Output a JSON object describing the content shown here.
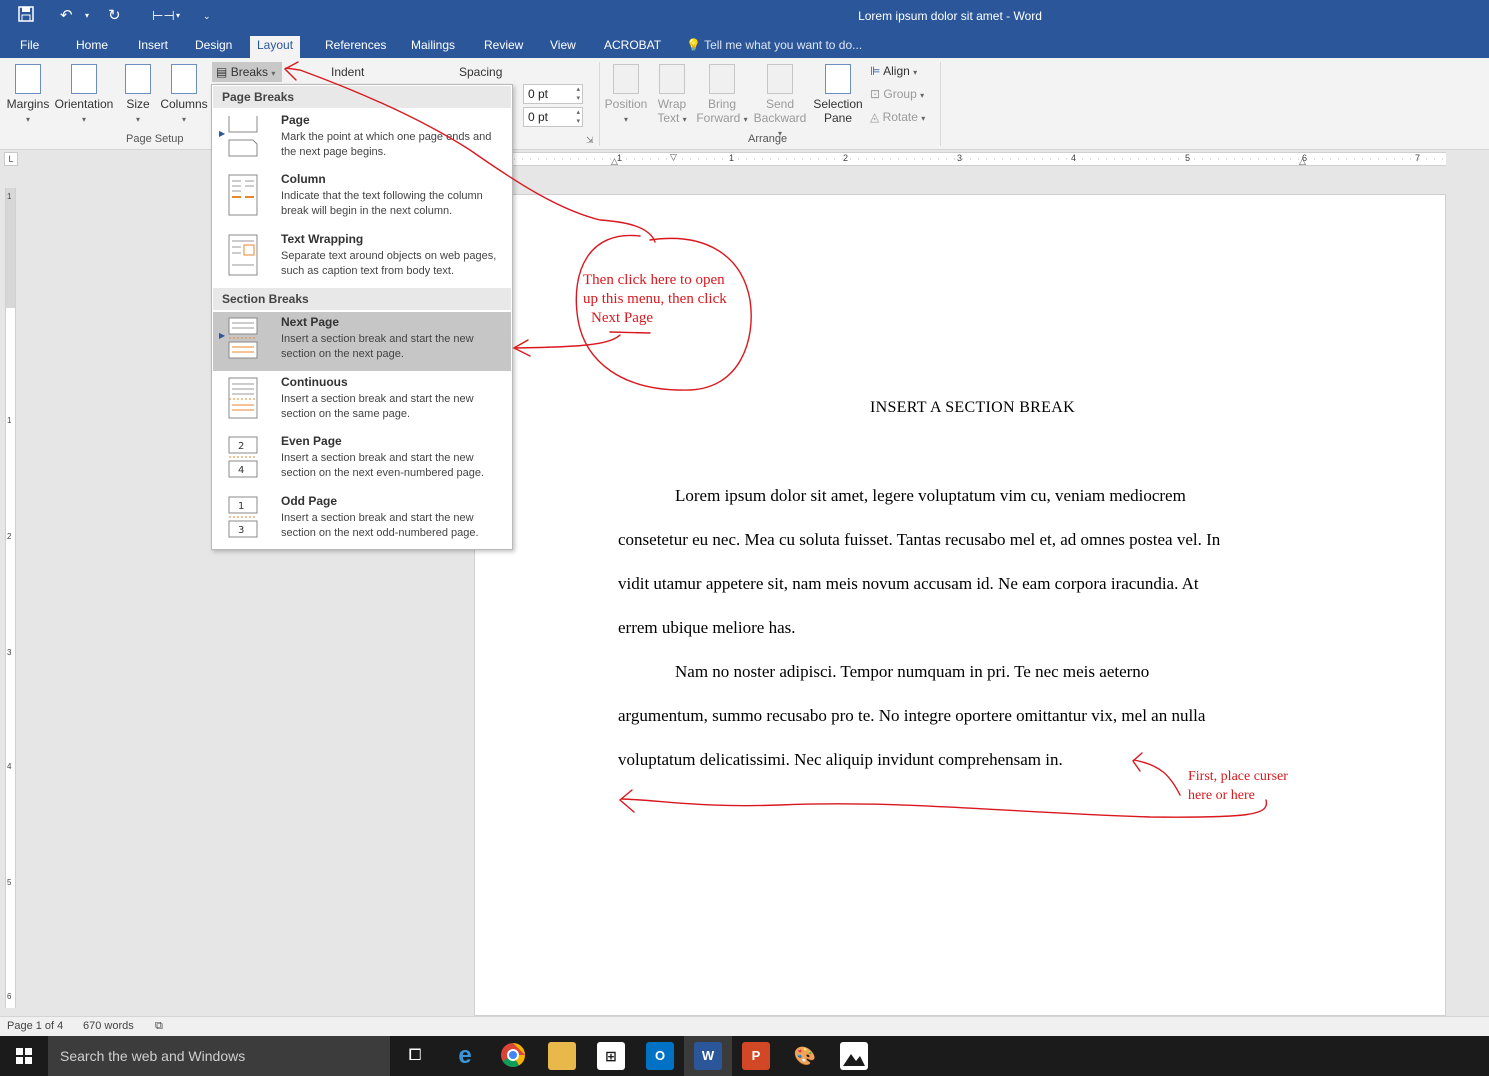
{
  "window": {
    "title": "Lorem ipsum dolor sit amet - Word"
  },
  "quick_access": {
    "save": "save-icon",
    "undo": "undo-icon",
    "redo": "redo-icon",
    "touch": "touch-mode-icon",
    "customize": "customize-icon"
  },
  "tabs": [
    {
      "label": "File"
    },
    {
      "label": "Home"
    },
    {
      "label": "Insert"
    },
    {
      "label": "Design"
    },
    {
      "label": "Layout"
    },
    {
      "label": "References"
    },
    {
      "label": "Mailings"
    },
    {
      "label": "Review"
    },
    {
      "label": "View"
    },
    {
      "label": "ACROBAT"
    }
  ],
  "tell_me": "Tell me what you want to do...",
  "ribbon": {
    "page_setup": {
      "margins": "Margins",
      "orientation": "Orientation",
      "size": "Size",
      "columns": "Columns",
      "breaks": "Breaks",
      "label": "Page Setup"
    },
    "paragraph": {
      "indent": "Indent",
      "spacing": "Spacing",
      "before": "0 pt",
      "after": "0 pt"
    },
    "arrange": {
      "position": "Position",
      "wrap_1": "Wrap",
      "wrap_2": "Text",
      "bring_1": "Bring",
      "bring_2": "Forward",
      "send_1": "Send",
      "send_2": "Backward",
      "selection_1": "Selection",
      "selection_2": "Pane",
      "align": "Align",
      "group": "Group",
      "rotate": "Rotate",
      "label": "Arrange"
    }
  },
  "breaks_menu": {
    "page_breaks_header": "Page Breaks",
    "section_breaks_header": "Section Breaks",
    "items": [
      {
        "title": "Page",
        "desc": "Mark the point at which one page ends and the next page begins."
      },
      {
        "title": "Column",
        "desc": "Indicate that the text following the column break will begin in the next column."
      },
      {
        "title": "Text Wrapping",
        "desc": "Separate text around objects on web pages, such as caption text from body text."
      },
      {
        "title": "Next Page",
        "desc": "Insert a section break and start the new section on the next page."
      },
      {
        "title": "Continuous",
        "desc": "Insert a section break and start the new section on the same page."
      },
      {
        "title": "Even Page",
        "desc": "Insert a section break and start the new section on the next even-numbered page."
      },
      {
        "title": "Odd Page",
        "desc": "Insert a section break and start the new section on the next odd-numbered page."
      }
    ]
  },
  "ruler": {
    "h_numbers": [
      "1",
      "1",
      "2",
      "3",
      "4",
      "5",
      "6",
      "7"
    ],
    "v_numbers": [
      "1",
      "1",
      "2",
      "3",
      "4",
      "5",
      "6"
    ]
  },
  "document": {
    "heading": "INSERT A SECTION BREAK",
    "para1_lines": [
      "Lorem ipsum dolor sit amet, legere voluptatum vim cu, veniam mediocrem",
      "consetetur eu nec. Mea cu soluta fuisset. Tantas recusabo mel et, ad omnes postea vel. In",
      "vidit utamur appetere sit, nam meis novum accusam id. Ne eam corpora iracundia. At",
      "errem ubique meliore has."
    ],
    "para2_lines": [
      "Nam no noster adipisci. Tempor numquam in pri. Te nec meis aeterno",
      "argumentum, summo recusabo pro te. No integre oportere omittantur vix, mel an nulla",
      "voluptatum delicatissimi. Nec aliquip invidunt comprehensam in."
    ]
  },
  "annotations": {
    "menu_note": [
      "Then click here to open",
      "up this menu, then click",
      "Next Page"
    ],
    "cursor_note": [
      "First, place curser",
      "here or here"
    ],
    "color": "#d9181e"
  },
  "status": {
    "page": "Page 1 of 4",
    "words": "670 words"
  },
  "taskbar": {
    "search_placeholder": "Search the web and Windows"
  },
  "colors": {
    "word_blue": "#2b579a",
    "page": "#ffffff",
    "menu_highlight": "#c6c6c6"
  }
}
